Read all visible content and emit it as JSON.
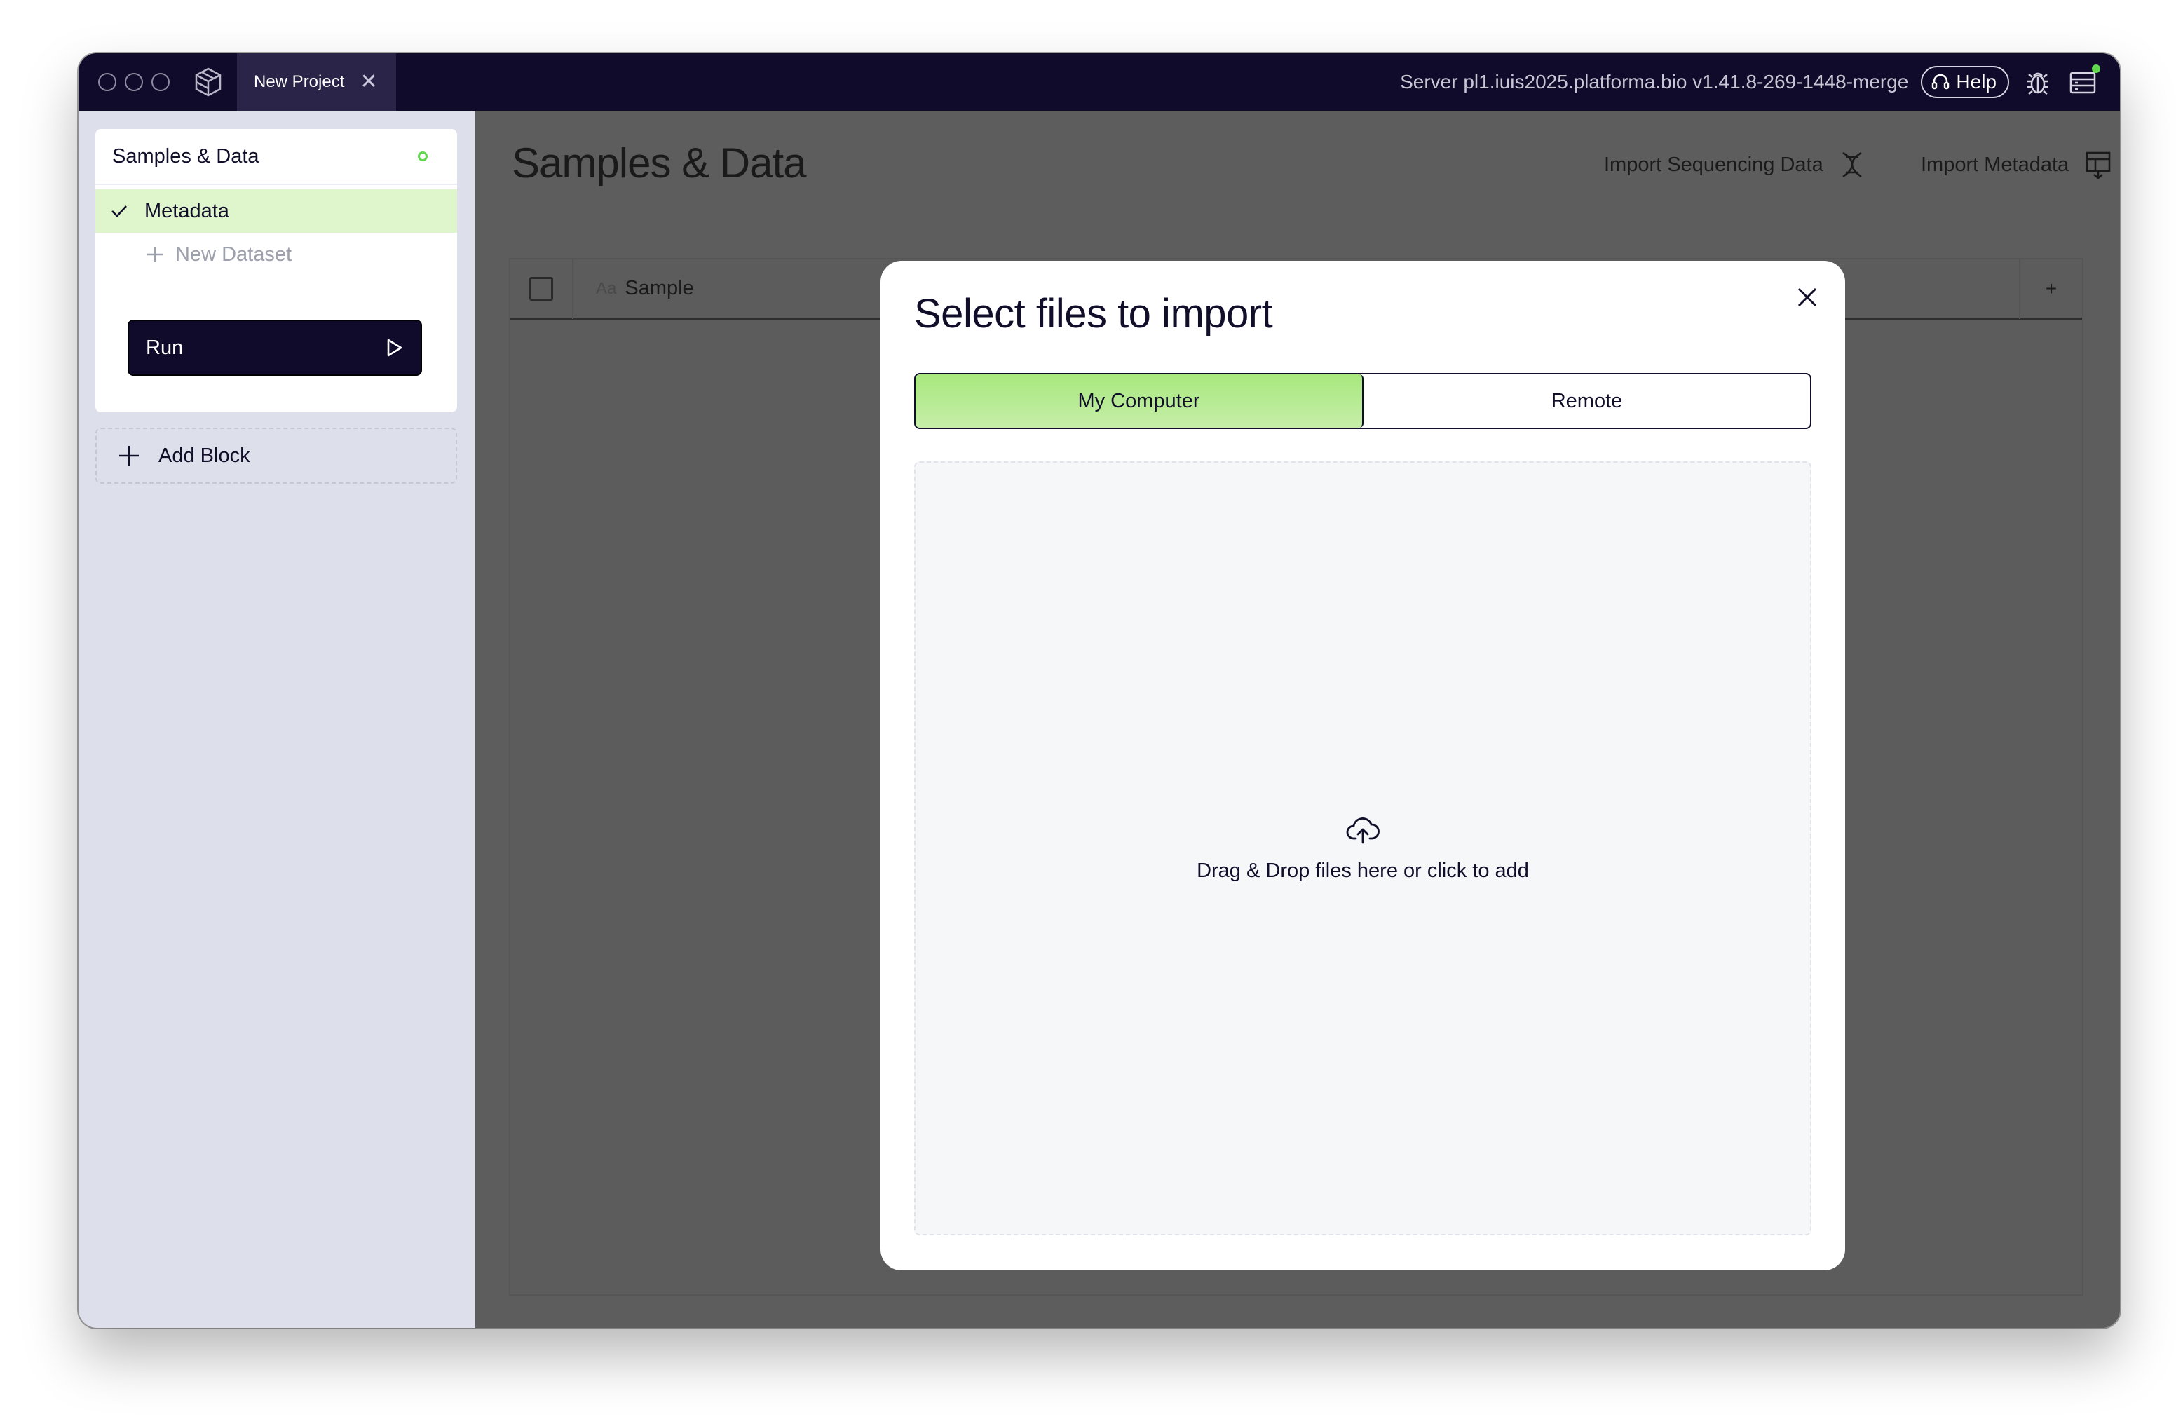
{
  "titlebar": {
    "tab_label": "New Project",
    "tab_close": "✕",
    "server_text": "Server pl1.iuis2025.platforma.bio v1.41.8-269-1448-merge",
    "help_label": "Help",
    "status_dot_color": "#5fd84d"
  },
  "sidebar": {
    "block_title": "Samples & Data",
    "items": [
      {
        "label": "Metadata",
        "icon": "check-icon",
        "active": true
      },
      {
        "label": "New Dataset",
        "icon": "plus-icon",
        "active": false
      }
    ],
    "run_label": "Run",
    "add_block_label": "Add Block"
  },
  "main": {
    "title": "Samples & Data",
    "import_sequencing_label": "Import Sequencing Data",
    "import_metadata_label": "Import Metadata",
    "table": {
      "type_glyph": "Aa",
      "column_sample": "Sample",
      "add_column": "+"
    }
  },
  "modal": {
    "title": "Select files to import",
    "tabs": [
      {
        "label": "My Computer",
        "active": true
      },
      {
        "label": "Remote",
        "active": false
      }
    ],
    "dropzone_text": "Drag & Drop files here or click to add"
  },
  "colors": {
    "accent_green": "#a8e87e",
    "dark": "#110b2b"
  }
}
